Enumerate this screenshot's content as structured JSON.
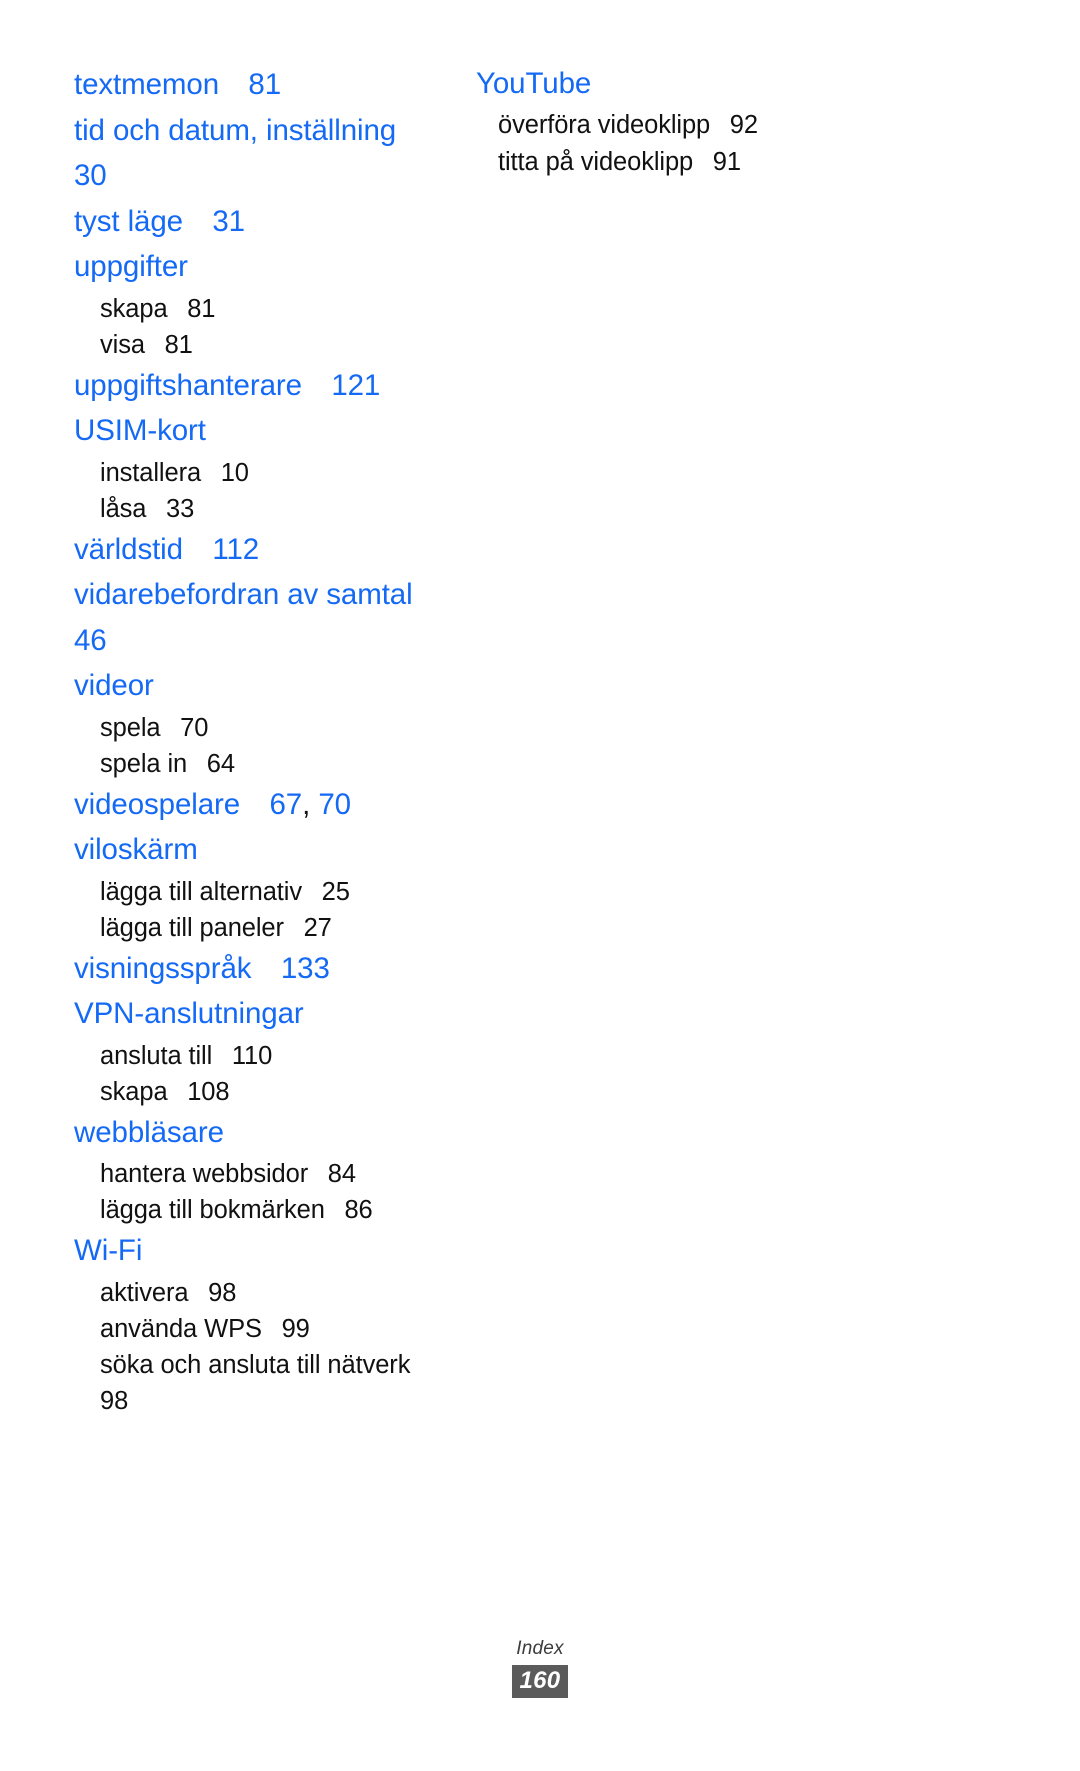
{
  "page": {
    "footer_label": "Index",
    "page_number": "160",
    "accent_color": "#1469f5",
    "text_color": "#111111",
    "badge_color": "#5b5b5b",
    "background": "#ffffff"
  },
  "left_column": [
    {
      "term": "textmemon",
      "pages": "81",
      "subentries": []
    },
    {
      "term": "tid och datum, inställning",
      "pages": "30",
      "subentries": []
    },
    {
      "term": "tyst läge",
      "pages": "31",
      "subentries": []
    },
    {
      "term": "uppgifter",
      "pages": "",
      "subentries": [
        {
          "term": "skapa",
          "pages": "81"
        },
        {
          "term": "visa",
          "pages": "81"
        }
      ]
    },
    {
      "term": "uppgiftshanterare",
      "pages": "121",
      "subentries": []
    },
    {
      "term": "USIM-kort",
      "pages": "",
      "subentries": [
        {
          "term": "installera",
          "pages": "10"
        },
        {
          "term": "låsa",
          "pages": "33"
        }
      ]
    },
    {
      "term": "världstid",
      "pages": "112",
      "subentries": []
    },
    {
      "term": "vidarebefordran av samtal",
      "pages": "46",
      "subentries": []
    },
    {
      "term": "videor",
      "pages": "",
      "subentries": [
        {
          "term": "spela",
          "pages": "70"
        },
        {
          "term": "spela in",
          "pages": "64"
        }
      ]
    },
    {
      "term": "videospelare",
      "pages": "67, 70",
      "page_list": [
        "67",
        "70"
      ],
      "subentries": []
    },
    {
      "term": "viloskärm",
      "pages": "",
      "subentries": [
        {
          "term": "lägga till alternativ",
          "pages": "25"
        },
        {
          "term": "lägga till paneler",
          "pages": "27"
        }
      ]
    },
    {
      "term": "visningsspråk",
      "pages": "133",
      "subentries": []
    },
    {
      "term": "VPN-anslutningar",
      "pages": "",
      "subentries": [
        {
          "term": "ansluta till",
          "pages": "110"
        },
        {
          "term": "skapa",
          "pages": "108"
        }
      ]
    },
    {
      "term": "webbläsare",
      "pages": "",
      "subentries": [
        {
          "term": "hantera webbsidor",
          "pages": "84"
        },
        {
          "term": "lägga till bokmärken",
          "pages": "86"
        }
      ]
    },
    {
      "term": "Wi-Fi",
      "pages": "",
      "subentries": [
        {
          "term": "aktivera",
          "pages": "98"
        },
        {
          "term": "använda WPS",
          "pages": "99"
        },
        {
          "term": "söka och ansluta till nätverk",
          "pages": "98"
        }
      ]
    }
  ],
  "right_column": [
    {
      "term": "YouTube",
      "pages": "",
      "subentries": [
        {
          "term": "överföra videoklipp",
          "pages": "92"
        },
        {
          "term": "titta på videoklipp",
          "pages": "91"
        }
      ]
    }
  ]
}
